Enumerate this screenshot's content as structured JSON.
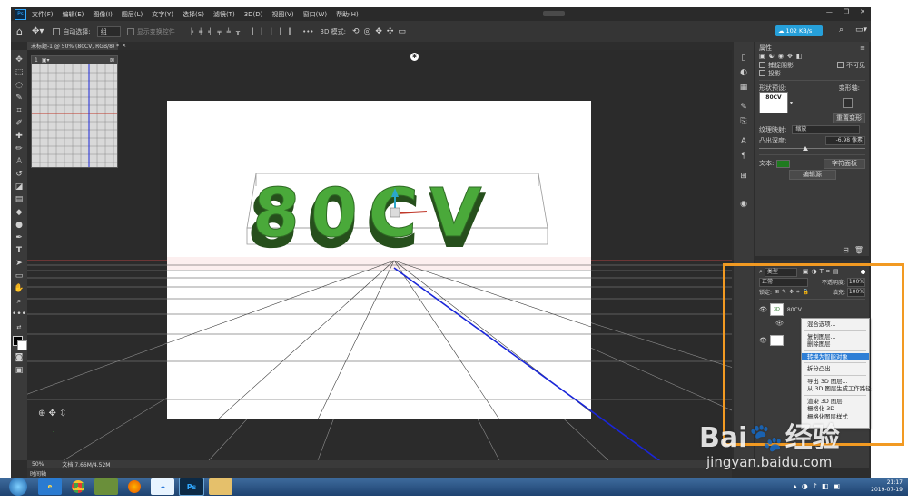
{
  "menu": [
    "文件(F)",
    "编辑(E)",
    "图像(I)",
    "图层(L)",
    "文字(Y)",
    "选择(S)",
    "滤镜(T)",
    "3D(D)",
    "视图(V)",
    "窗口(W)",
    "帮助(H)"
  ],
  "window_controls": {
    "minimize": "—",
    "maximize": "❐",
    "close": "✕"
  },
  "options_bar": {
    "auto_select_label": "自动选择:",
    "auto_select_value": "组",
    "show_transform_label": "显示变换控件",
    "mode_3d_label": "3D 模式:",
    "more": "•••"
  },
  "network_badge": "102 KB/s",
  "doc_tab": {
    "title": "未标题-1 @ 50% (80CV, RGB/8) *",
    "close": "×"
  },
  "mini_view_tab": "1",
  "artwork_text": "80CV",
  "status_bar": {
    "zoom": "50%",
    "doc_info": "文档:7.66M/4.52M",
    "timeline": "时间轴"
  },
  "properties": {
    "title": "属性",
    "tabs": [
      "网格",
      "变形",
      "盖子",
      "坐标",
      "环境"
    ],
    "catch_shadows": "捕捉阴影",
    "cast_shadows": "投影",
    "invisible": "不可见",
    "shape_preset_label": "形状预设:",
    "deform_axis_label": "变形轴:",
    "reset_deform": "重置变形",
    "texture_map_label": "纹理映射:",
    "texture_map_value": "缩放",
    "extrusion_label": "凸出深度:",
    "extrusion_value": "-6.98 像素",
    "text_label": "文本:",
    "char_panel": "字符面板",
    "edit_source": "编辑源",
    "preview_text": "80CV"
  },
  "layers": {
    "filter_label": "类型",
    "blend_mode": "正常",
    "opacity_label": "不透明度:",
    "opacity_value": "100%",
    "lock_label": "锁定:",
    "fill_label": "填充:",
    "fill_value": "100%",
    "layer1_name": "80CV"
  },
  "context_menu": {
    "groups": [
      [
        "混合选项..."
      ],
      [
        "复制图层...",
        "删除图层"
      ],
      [
        "转换为智能对象"
      ],
      [
        "拆分凸出"
      ],
      [
        "导出 3D 图层...",
        "从 3D 图层生成工作路径"
      ],
      [
        "渲染 3D 图层",
        "栅格化 3D",
        "栅格化图层样式"
      ]
    ],
    "highlighted": "转换为智能对象"
  },
  "taskbar": {
    "time": "21:17",
    "date": "2019-07-19"
  },
  "watermark": {
    "logo_left": "Bai",
    "logo_right": "经验",
    "url": "jingyan.baidu.com"
  },
  "colors": {
    "ps_bg": "#2d2d2d",
    "ps_panel": "#3b3b3b",
    "ps_bar": "#353535",
    "highlight_box": "#f29a22",
    "letter_green": "#4aa93a",
    "letter_dark": "#264f1c",
    "ctx_highlight": "#2f7fd6",
    "grid_blue": "#1a26d9"
  }
}
